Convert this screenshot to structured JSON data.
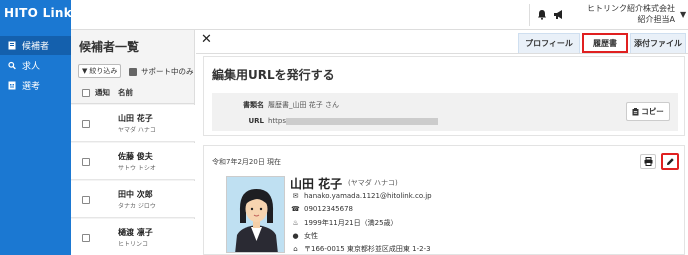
{
  "app": {
    "brand": "HITO Link"
  },
  "nav": {
    "items": [
      {
        "label": "候補者",
        "icon": "badge-icon",
        "active": true
      },
      {
        "label": "求人",
        "icon": "search-icon",
        "active": false
      },
      {
        "label": "選考",
        "icon": "document-icon",
        "active": false
      }
    ]
  },
  "header": {
    "company": "ヒトリンク紹介株式会社",
    "user_role": "紹介担当A"
  },
  "list": {
    "title": "候補者一覧",
    "filter_label": "絞り込み",
    "support_label": "サポート中のみ",
    "col_notify": "通知",
    "col_name": "名前",
    "rows": [
      {
        "name": "山田 花子",
        "kana": "ヤマダ ハナコ"
      },
      {
        "name": "佐藤 俊夫",
        "kana": "サトウ トシオ"
      },
      {
        "name": "田中 次郎",
        "kana": "タナカ ジロウ"
      },
      {
        "name": "樋渡 凛子",
        "kana": "ヒトリンコ"
      }
    ]
  },
  "main": {
    "close_glyph": "✕",
    "tabs": [
      {
        "label": "プロフィール",
        "active": false
      },
      {
        "label": "履歴書",
        "active": true
      },
      {
        "label": "添付ファイル",
        "active": false
      }
    ],
    "url_section": {
      "heading": "編集用URLを発行する",
      "doc_label": "書類名",
      "doc_value": "履歴書_山田 花子 さん",
      "url_label": "URL",
      "url_value": "https://",
      "copy_label": "コピー"
    },
    "resume": {
      "date": "令和7年2月20日 現在",
      "name": "山田 花子",
      "kana": "(ヤマダ ハナコ)",
      "email": "hanako.yamada.1121@hitolink.co.jp",
      "phone": "09012345678",
      "birth": "1999年11月21日（満25歳）",
      "gender": "女性",
      "address": "〒166-0015 東京都杉並区成田東 1-2-3"
    }
  },
  "colors": {
    "nav_bg": "#1b78d2",
    "highlight": "#e02020"
  }
}
